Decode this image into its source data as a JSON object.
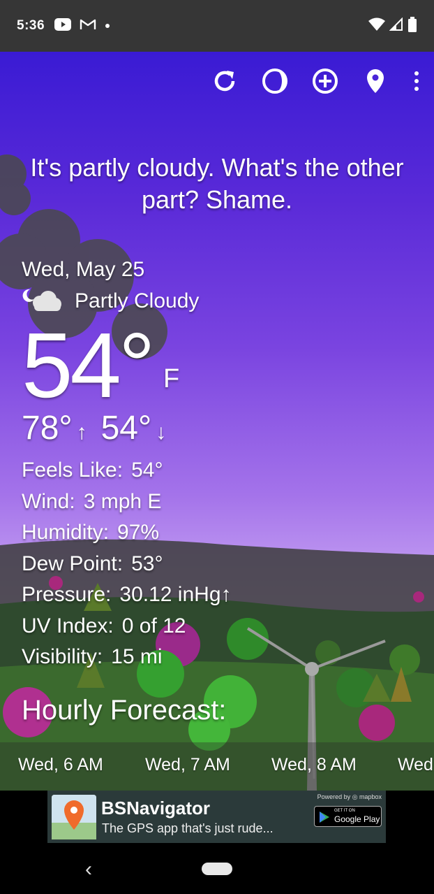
{
  "status_bar": {
    "time": "5:36"
  },
  "toolbar": {
    "icons": [
      "refresh-icon",
      "moon-phase-icon",
      "add-location-icon",
      "location-pin-icon",
      "more-vert-icon"
    ]
  },
  "tagline": "It's partly cloudy. What's the other part? Shame.",
  "weather": {
    "date": "Wed, May 25",
    "condition": "Partly Cloudy",
    "temperature": "54°",
    "unit": "F",
    "high": "78°",
    "high_arrow": "↑",
    "low": "54°",
    "low_arrow": "↓",
    "details": [
      {
        "label": "Feels Like:",
        "value": "54°"
      },
      {
        "label": "Wind:",
        "value": "3 mph E"
      },
      {
        "label": "Humidity:",
        "value": "97%"
      },
      {
        "label": "Dew Point:",
        "value": "53°"
      },
      {
        "label": "Pressure:",
        "value": "30.12 inHg↑"
      },
      {
        "label": "UV Index:",
        "value": "0 of 12"
      },
      {
        "label": "Visibility:",
        "value": "15 mi"
      }
    ]
  },
  "hourly": {
    "title": "Hourly Forecast:",
    "items": [
      "Wed, 6 AM",
      "Wed, 7 AM",
      "Wed, 8 AM",
      "Wed"
    ]
  },
  "ad": {
    "title": "BSNavigator",
    "subtitle": "The GPS app that's just rude...",
    "powered_by": "Powered by ◎ mapbox",
    "store_small": "GET IT ON",
    "store_big": "Google Play"
  },
  "nav": {
    "back": "‹"
  },
  "colors": {
    "sky_top": "#3a1bd4",
    "sky_bottom": "#c7a6f2",
    "status_bar": "#363636"
  }
}
